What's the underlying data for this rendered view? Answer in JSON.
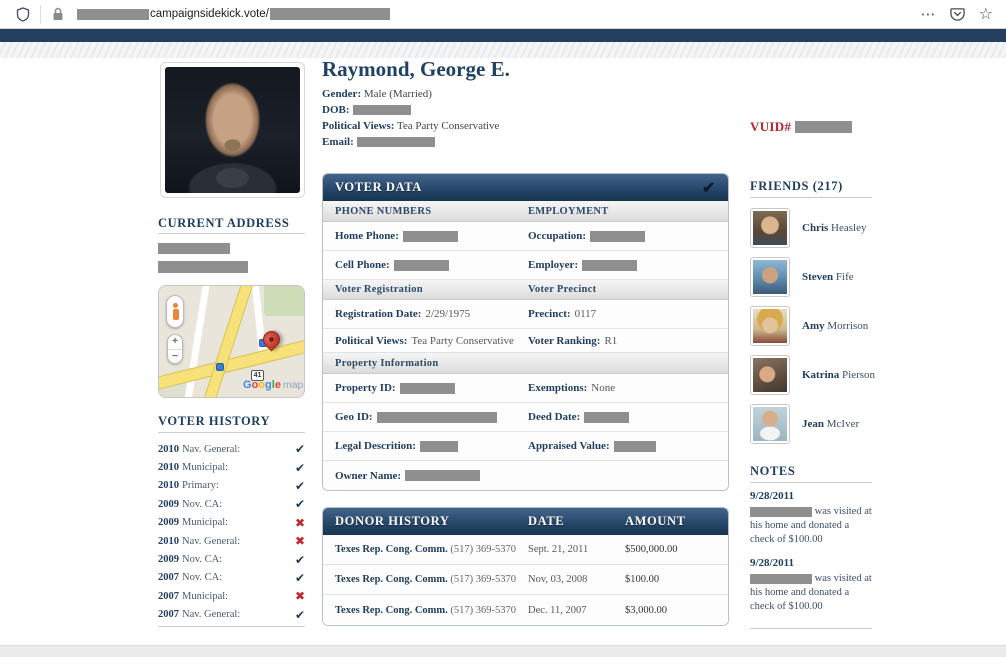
{
  "browser": {
    "url_domain": "campaignsidekick.vote/",
    "more_label": "⋯",
    "bookmark_star": "☆"
  },
  "colors": {
    "accent_navy": "#1e3c5f",
    "header_gradient_top": "#44658a",
    "header_gradient_bottom": "#16344f",
    "vuid_red": "#b5242a",
    "check_mark": "#1c3a58",
    "x_mark": "#c3262c",
    "redaction_gray": "#8f8f8f"
  },
  "profile": {
    "name": "Raymond, George E.",
    "gender_label": "Gender:",
    "gender_value": "Male (Married)",
    "dob_label": "DOB:",
    "views_label": "Political Views:",
    "views_value": "Tea Party Conservative",
    "email_label": "Email:",
    "vuid_label": "VUID#"
  },
  "current_address": {
    "title": "CURRENT ADDRESS"
  },
  "map": {
    "google_letters": [
      "G",
      "o",
      "o",
      "g",
      "l",
      "e"
    ],
    "maps_word": "maps",
    "zoom_in": "+",
    "zoom_out": "−",
    "route_badge": "41"
  },
  "voter_history": {
    "title": "VOTER HISTORY",
    "items": [
      {
        "year": "2010",
        "label": "Nav. General:",
        "mark": "✔",
        "voted": true
      },
      {
        "year": "2010",
        "label": "Municipal:",
        "mark": "✔",
        "voted": true
      },
      {
        "year": "2010",
        "label": "Primary:",
        "mark": "✔",
        "voted": true
      },
      {
        "year": "2009",
        "label": "Nov. CA:",
        "mark": "✔",
        "voted": true
      },
      {
        "year": "2009",
        "label": "Municipal:",
        "mark": "✖",
        "voted": false
      },
      {
        "year": "2010",
        "label": "Nav. General:",
        "mark": "✖",
        "voted": false
      },
      {
        "year": "2009",
        "label": "Nov. CA:",
        "mark": "✔",
        "voted": true
      },
      {
        "year": "2007",
        "label": "Nov. CA:",
        "mark": "✔",
        "voted": true
      },
      {
        "year": "2007",
        "label": "Municipal:",
        "mark": "✖",
        "voted": false
      },
      {
        "year": "2007",
        "label": "Nav. General:",
        "mark": "✔",
        "voted": true
      }
    ]
  },
  "voter_data": {
    "title": "VOTER DATA",
    "check": "✔",
    "sub1_left": "PHONE NUMBERS",
    "sub1_right": "EMPLOYMENT",
    "sub2_left": "Voter Registration",
    "sub2_right": "Voter Precinct",
    "sub3_left": "Property Information",
    "rows": {
      "home_phone_label": "Home Phone:",
      "occupation_label": "Occupation:",
      "cell_phone_label": "Cell Phone:",
      "employer_label": "Employer:",
      "reg_date_label": "Registration Date:",
      "reg_date_value": "2/29/1975",
      "precinct_label": "Precinct:",
      "precinct_value": "0117",
      "views_label": "Political Views:",
      "views_value": "Tea Party Conservative",
      "ranking_label": "Voter Ranking:",
      "ranking_value": "R1",
      "property_id_label": "Property ID:",
      "exemptions_label": "Exemptions:",
      "exemptions_value": "None",
      "geo_id_label": "Geo ID:",
      "deed_date_label": "Deed Date:",
      "legal_label": "Legal Descrition:",
      "appraised_label": "Appraised Value:",
      "owner_label": "Owner Name:"
    }
  },
  "donor_history": {
    "title": "DONOR HISTORY",
    "col_date": "DATE",
    "col_amount": "AMOUNT",
    "rows": [
      {
        "name": "Texes Rep. Cong. Comm.",
        "phone": "(517) 369-5370",
        "date": "Sept. 21, 2011",
        "amount": "$500,000.00"
      },
      {
        "name": "Texes Rep. Cong. Comm.",
        "phone": "(517) 369-5370",
        "date": "Nov, 03, 2008",
        "amount": "$100.00"
      },
      {
        "name": "Texes Rep. Cong. Comm.",
        "phone": "(517) 369-5370",
        "date": "Dec. 11, 2007",
        "amount": "$3,000.00"
      }
    ]
  },
  "friends": {
    "title": "FRIENDS (217)",
    "items": [
      {
        "first": "Chris",
        "last": "Heasley"
      },
      {
        "first": "Steven",
        "last": "Fife"
      },
      {
        "first": "Amy",
        "last": "Morrison"
      },
      {
        "first": "Katrina",
        "last": "Pierson"
      },
      {
        "first": "Jean",
        "last": "McIver"
      }
    ]
  },
  "notes": {
    "title": "NOTES",
    "items": [
      {
        "date": "9/28/2011",
        "text": " was visited at his home and donated a check of $100.00"
      },
      {
        "date": "9/28/2011",
        "text": " was visited at his home and donated a check of $100.00"
      }
    ]
  }
}
